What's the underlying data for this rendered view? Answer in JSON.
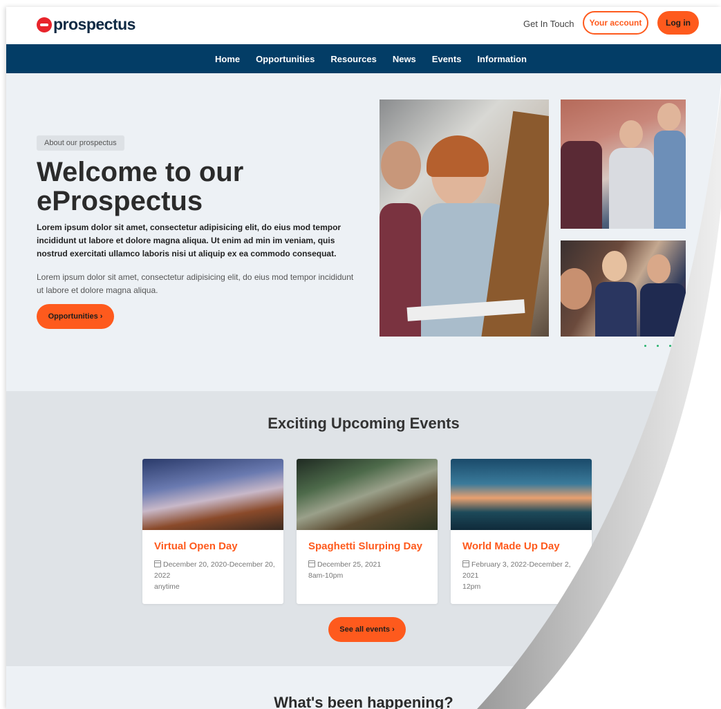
{
  "header": {
    "logo_text": "prospectus",
    "get_in_touch": "Get In Touch",
    "account_label": "Your account",
    "login_label": "Log in"
  },
  "nav": {
    "items": [
      {
        "label": "Home"
      },
      {
        "label": "Opportunities"
      },
      {
        "label": "Resources"
      },
      {
        "label": "News"
      },
      {
        "label": "Events"
      },
      {
        "label": "Information"
      }
    ]
  },
  "hero": {
    "pill": "About our prospectus",
    "title": "Welcome to our eProspectus",
    "lead": "Lorem ipsum dolor sit amet, consectetur adipisicing elit, do eius mod tempor incididunt ut labore et dolore magna aliqua. Ut enim ad min im veniam, quis nostrud exercitati ullamco laboris nisi ut aliquip ex ea commodo consequat.",
    "body": "Lorem ipsum dolor sit amet, consectetur adipisicing elit, do eius mod tempor incididunt ut labore et dolore magna aliqua.",
    "button_label": "Opportunities ›"
  },
  "events": {
    "title": "Exciting Upcoming Events",
    "cards": [
      {
        "title": "Virtual Open Day",
        "date": "December 20, 2020-December 20, 2022",
        "time": "anytime"
      },
      {
        "title": "Spaghetti Slurping Day",
        "date": "December 25, 2021",
        "time": "8am-10pm"
      },
      {
        "title": "World Made Up Day",
        "date": "February 3, 2022-December 2, 2021",
        "time": "12pm"
      }
    ],
    "see_all_label": "See all events ›"
  },
  "happening": {
    "title": "What's been happening?"
  },
  "colors": {
    "accent": "#fe5a1d",
    "nav_bg": "#033d66",
    "logo_red": "#e8242b",
    "hero_bg": "#edf1f5",
    "events_bg": "#dfe3e7",
    "dot_green": "#28b46e"
  },
  "icons": [
    "calendar-icon",
    "chevron-right-icon"
  ]
}
